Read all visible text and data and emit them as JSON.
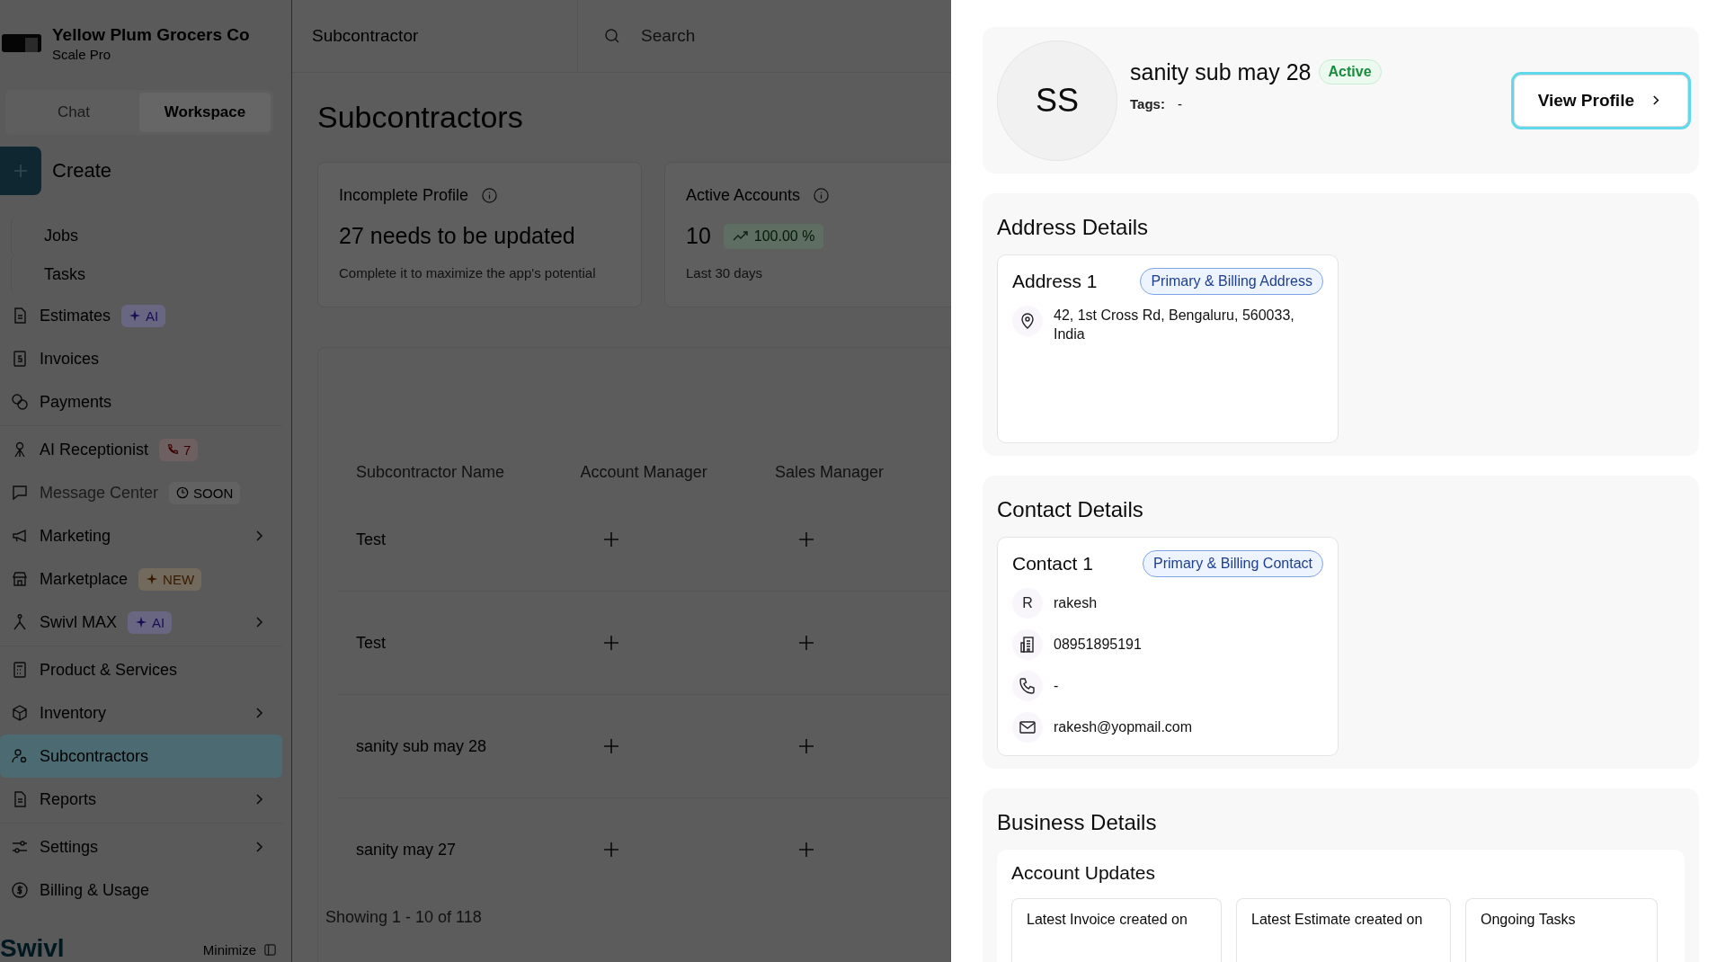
{
  "sidebar": {
    "brand": {
      "name": "Yellow Plum Grocers Co",
      "plan": "Scale Pro"
    },
    "tabs": [
      {
        "label": "Chat",
        "selected": false
      },
      {
        "label": "Workspace",
        "selected": true
      }
    ],
    "create_button": "Create",
    "nav_groups": [
      {
        "items": [
          {
            "kind": "sub",
            "label": "Jobs",
            "selected": false,
            "expandable": false,
            "disabled": false
          },
          {
            "kind": "sub",
            "label": "Tasks",
            "selected": false,
            "expandable": false,
            "disabled": false
          },
          {
            "kind": "main",
            "label": "Estimates",
            "badge": {
              "kind": "ai",
              "text": "AI"
            },
            "selected": false,
            "expandable": false,
            "disabled": false
          },
          {
            "kind": "main",
            "label": "Invoices",
            "selected": false,
            "expandable": false,
            "disabled": false
          },
          {
            "kind": "main",
            "label": "Payments",
            "selected": false,
            "expandable": false,
            "disabled": false
          }
        ]
      },
      {
        "items": [
          {
            "kind": "main",
            "label": "AI Receptionist",
            "badge": {
              "kind": "calls",
              "text": "7"
            },
            "selected": false,
            "expandable": false,
            "disabled": false
          },
          {
            "kind": "main",
            "label": "Message Center",
            "badge": {
              "kind": "soon",
              "text": "SOON"
            },
            "selected": false,
            "expandable": false,
            "disabled": true
          },
          {
            "kind": "main",
            "label": "Marketing",
            "selected": false,
            "expandable": true,
            "disabled": false
          },
          {
            "kind": "main",
            "label": "Marketplace",
            "badge": {
              "kind": "new",
              "text": "NEW"
            },
            "selected": false,
            "expandable": false,
            "disabled": false
          },
          {
            "kind": "main",
            "label": "Swivl MAX",
            "badge": {
              "kind": "ai",
              "text": "AI"
            },
            "selected": false,
            "expandable": true,
            "disabled": false
          }
        ]
      },
      {
        "items": [
          {
            "kind": "main",
            "label": "Product & Services",
            "selected": false,
            "expandable": false,
            "disabled": false
          },
          {
            "kind": "main",
            "label": "Inventory",
            "selected": false,
            "expandable": true,
            "disabled": false
          },
          {
            "kind": "main",
            "label": "Subcontractors",
            "selected": true,
            "expandable": false,
            "disabled": false
          },
          {
            "kind": "main",
            "label": "Reports",
            "selected": false,
            "expandable": true,
            "disabled": false
          }
        ]
      },
      {
        "items": [
          {
            "kind": "main",
            "label": "Settings",
            "selected": false,
            "expandable": true,
            "disabled": false
          },
          {
            "kind": "main",
            "label": "Billing & Usage",
            "selected": false,
            "expandable": false,
            "disabled": false
          }
        ]
      }
    ],
    "footer": {
      "logo": "Swivl",
      "minimize": "Minimize"
    }
  },
  "header": {
    "breadcrumb": "Subcontractor",
    "search": {
      "placeholder": "Search"
    }
  },
  "page_title": "Subcontractors",
  "stat_cards": [
    {
      "title": "Incomplete Profile",
      "value": "27 needs to be updated",
      "caption": "Complete it to maximize the app's potential"
    },
    {
      "title": "Active Accounts",
      "value": "10",
      "trend": "100.00 %",
      "caption": "Last 30 days"
    }
  ],
  "table": {
    "columns": [
      "Subcontractor Name",
      "Account Manager",
      "Sales Manager"
    ],
    "rows": [
      {
        "name": "Test"
      },
      {
        "name": "Test"
      },
      {
        "name": "sanity sub may 28"
      },
      {
        "name": "sanity may 27"
      }
    ],
    "footer": "Showing 1 - 10 of 118"
  },
  "drawer": {
    "profile": {
      "initials": "SS",
      "name": "sanity sub may 28",
      "status": "Active",
      "tags_label": "Tags:",
      "tags": "-",
      "button": {
        "label": "View Profile",
        "focused": true
      }
    },
    "address_section": {
      "title": "Address Details",
      "cards": [
        {
          "title": "Address 1",
          "badge": "Primary & Billing Address",
          "address": "42, 1st Cross Rd, Bengaluru, 560033, India"
        }
      ]
    },
    "contact_section": {
      "title": "Contact Details",
      "cards": [
        {
          "title": "Contact 1",
          "badge": "Primary & Billing Contact",
          "fields": [
            {
              "kind": "name",
              "initial": "R",
              "value": "rakesh"
            },
            {
              "kind": "office",
              "value": "08951895191"
            },
            {
              "kind": "phone",
              "value": "-"
            },
            {
              "kind": "email",
              "value": "rakesh@yopmail.com"
            }
          ]
        }
      ]
    },
    "business_section": {
      "title": "Business Details",
      "subtitle": "Account Updates",
      "tiles": [
        "Latest Invoice created on",
        "Latest Estimate created on",
        "Ongoing Tasks"
      ]
    }
  }
}
